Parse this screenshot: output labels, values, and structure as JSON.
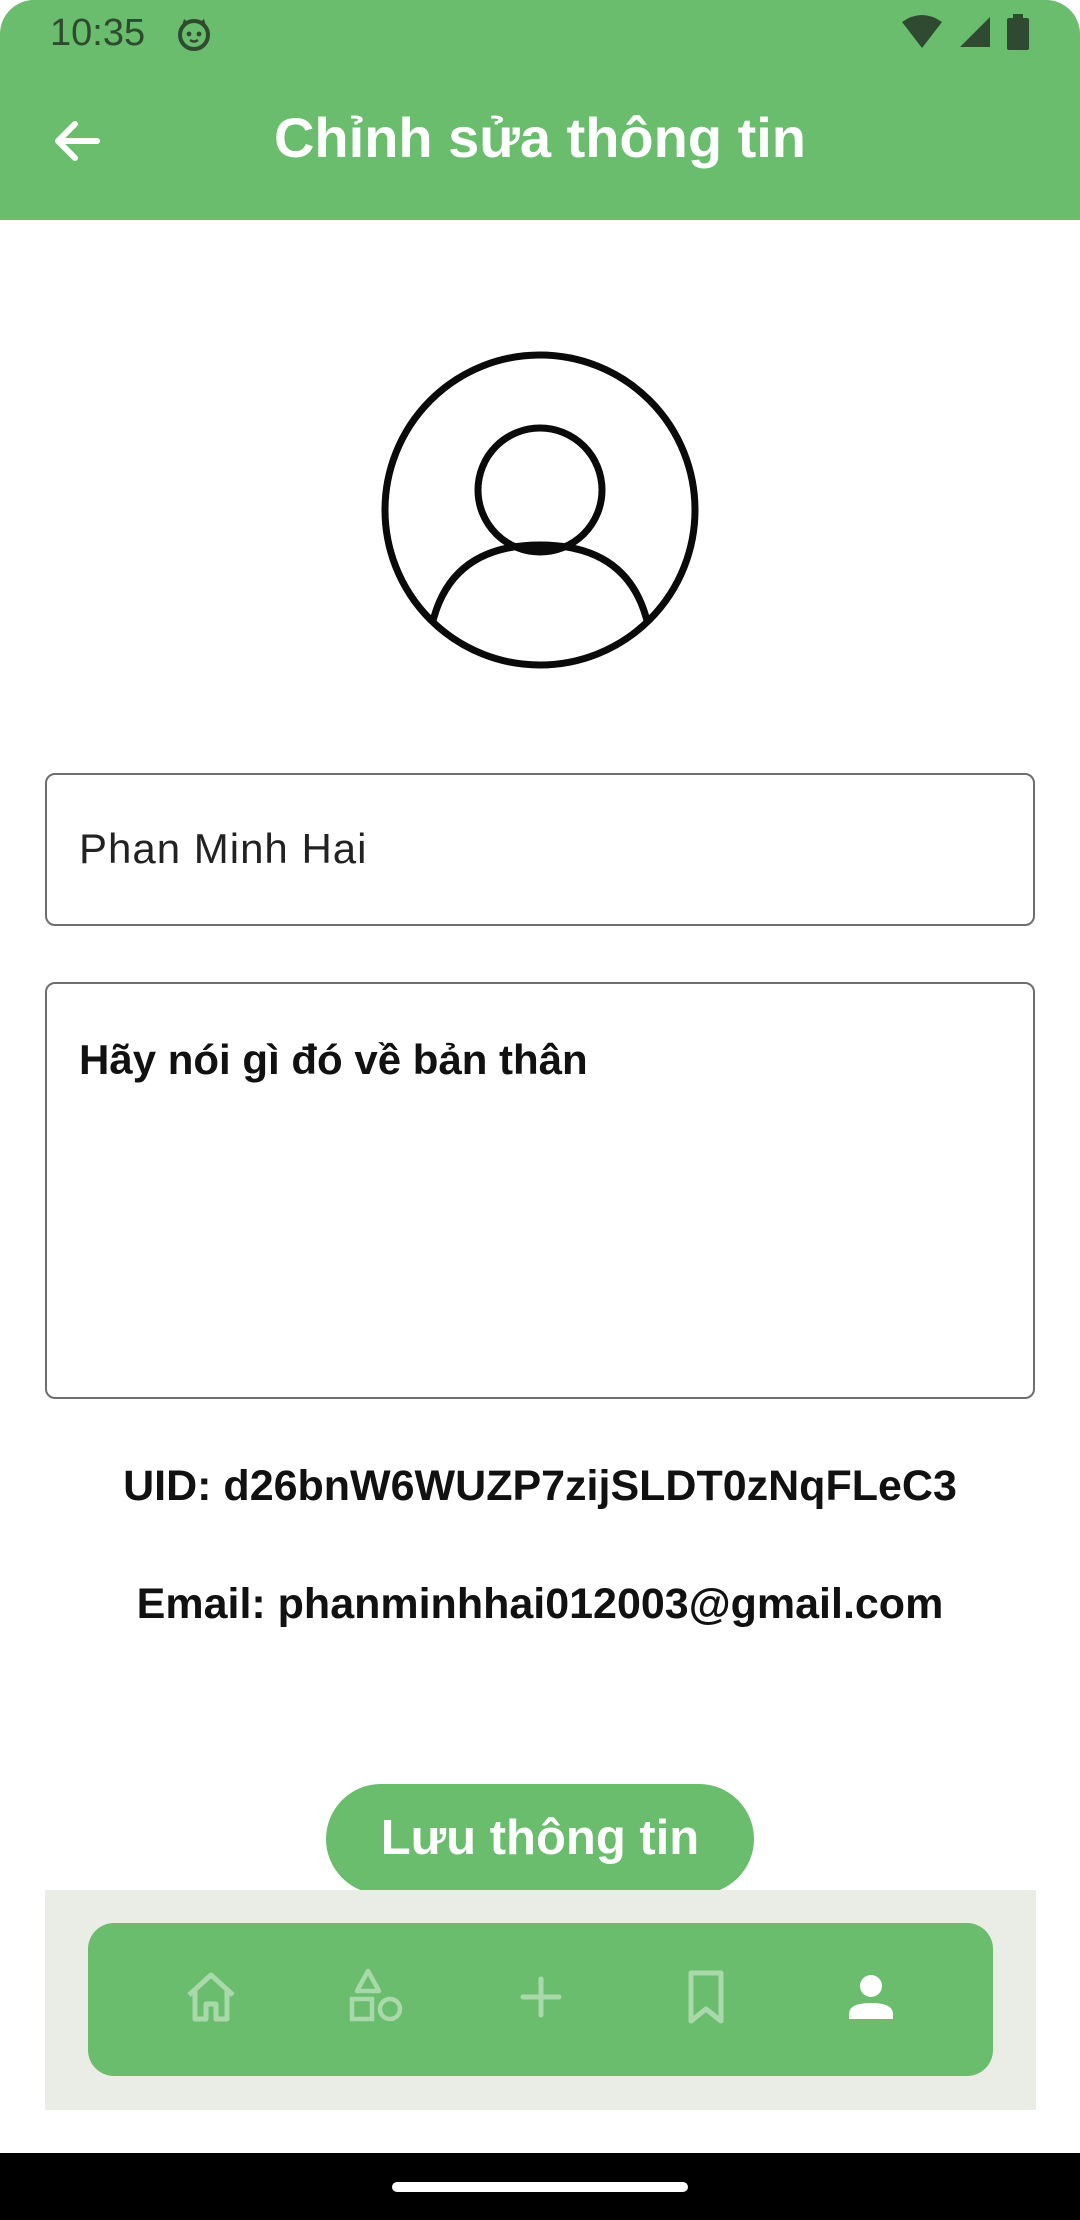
{
  "status_bar": {
    "time": "10:35",
    "icons": [
      "cat-notification-icon",
      "wifi-icon",
      "signal-icon",
      "battery-icon"
    ]
  },
  "app_bar": {
    "title": "Chỉnh sửa thông tin",
    "back_icon": "arrow-left-icon"
  },
  "profile": {
    "avatar_icon": "user-circle-icon",
    "name_value": "Phan Minh Hai",
    "bio_placeholder": "Hãy nói gì đó về bản thân",
    "uid_text": "UID: d26bnW6WUZP7zijSLDT0zNqFLeC3",
    "email_text": "Email: phanminhhai012003@gmail.com"
  },
  "actions": {
    "save_label": "Lưu thông tin"
  },
  "bottom_nav": {
    "items": [
      {
        "icon": "home-icon",
        "active": false
      },
      {
        "icon": "shapes-icon",
        "active": false
      },
      {
        "icon": "plus-icon",
        "active": false
      },
      {
        "icon": "bookmark-icon",
        "active": false
      },
      {
        "icon": "person-icon",
        "active": true
      }
    ]
  },
  "colors": {
    "primary_green": "#69bd6c",
    "nav_background": "#e9ede6",
    "nav_inactive": "#a9d9ab",
    "nav_active": "#ffffff"
  }
}
